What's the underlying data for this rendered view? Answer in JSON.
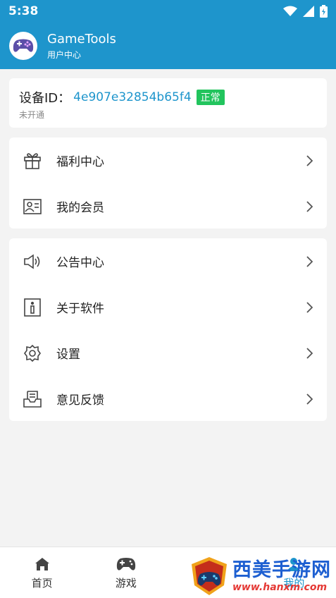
{
  "status_bar": {
    "time": "5:38"
  },
  "header": {
    "title": "GameTools",
    "subtitle": "用户中心"
  },
  "device": {
    "label": "设备ID：",
    "id": "4e907e32854b65f4",
    "badge": "正常",
    "status": "未开通"
  },
  "menu_group_1": [
    {
      "label": "福利中心",
      "icon": "gift-icon"
    },
    {
      "label": "我的会员",
      "icon": "member-card-icon"
    }
  ],
  "menu_group_2": [
    {
      "label": "公告中心",
      "icon": "speaker-icon"
    },
    {
      "label": "关于软件",
      "icon": "info-icon"
    },
    {
      "label": "设置",
      "icon": "gear-icon"
    },
    {
      "label": "意见反馈",
      "icon": "inbox-icon"
    }
  ],
  "bottom_nav": [
    {
      "label": "首页",
      "icon": "home-icon"
    },
    {
      "label": "游戏",
      "icon": "gamepad-icon"
    },
    {
      "label": "",
      "icon": ""
    },
    {
      "label": "我的",
      "icon": "user-icon"
    }
  ],
  "watermark": {
    "text": "西美手游网",
    "url": "www.hanxm.com"
  },
  "colors": {
    "primary": "#1e95cc",
    "badge": "#22c45d",
    "background": "#f3f3f3"
  }
}
